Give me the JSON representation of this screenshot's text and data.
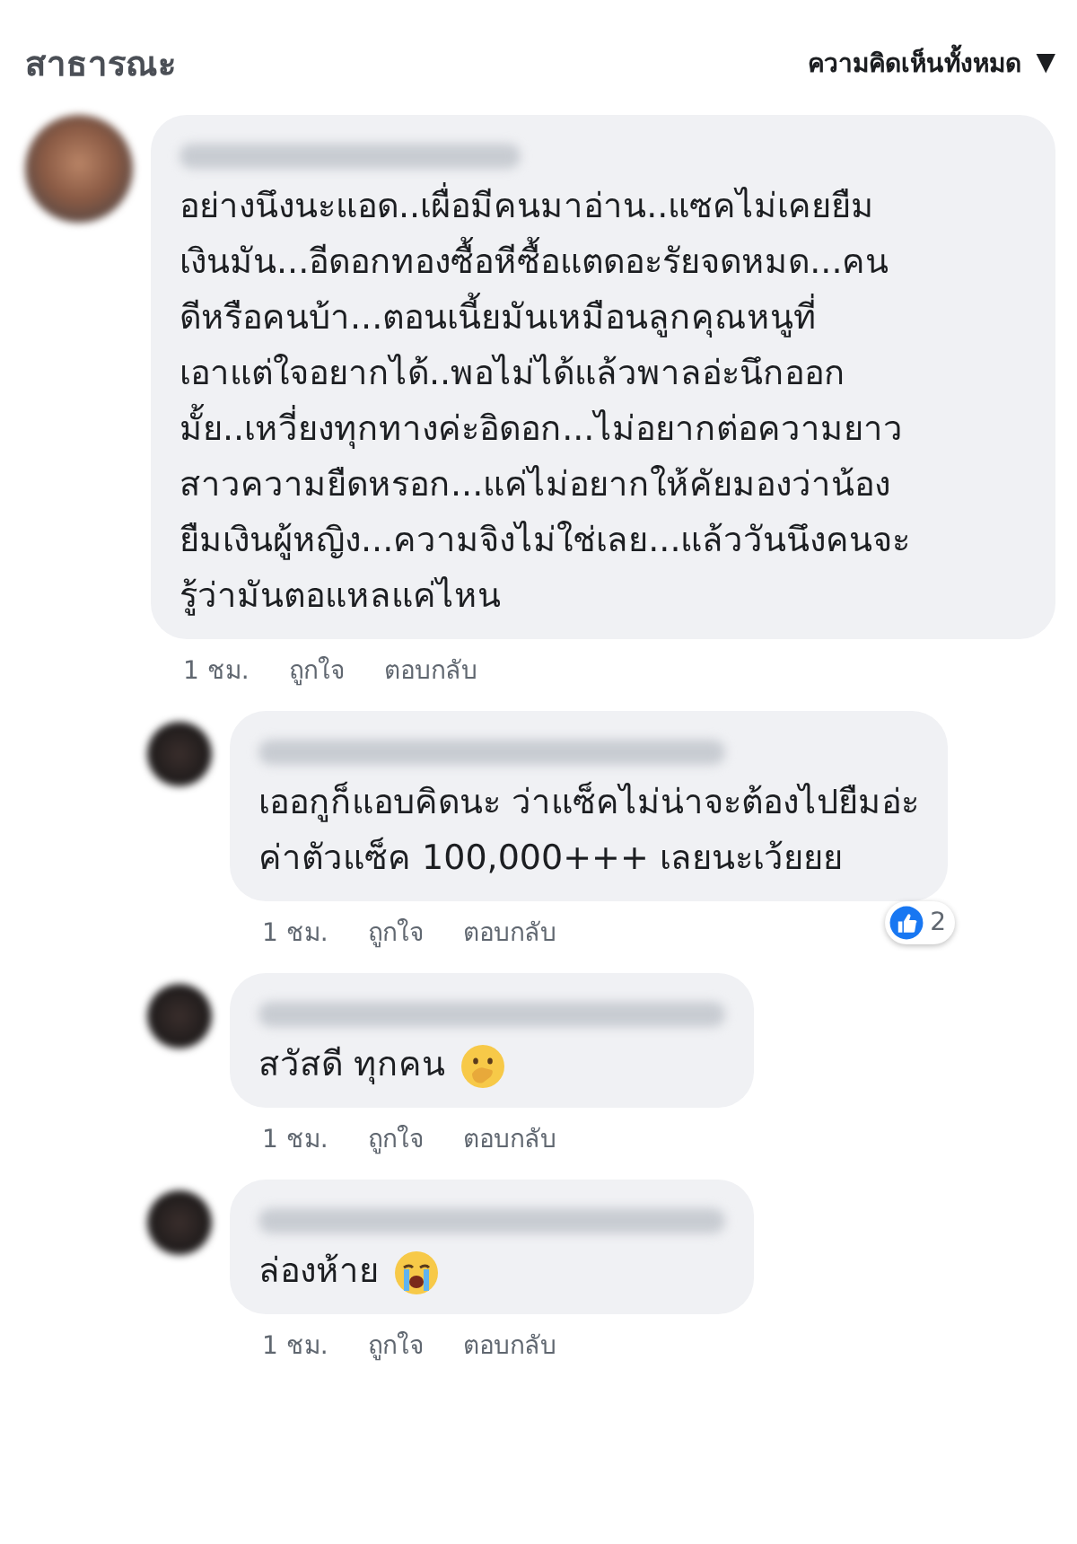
{
  "header": {
    "title": "สาธารณะ",
    "filter": {
      "label": "ความคิดเห็นทั้งหมด",
      "caret": "▼"
    }
  },
  "comments": [
    {
      "text": "อย่างนึงนะแอด..เผื่อมีคนมาอ่าน..แซคไม่เคยยืม\nเงินมัน...อีดอกทองซื้อหีซื้อแตดอะรัยจดหมด...คน\nดีหรือคนบ้า...ตอนเนี้ยมันเหมือนลูกคุณหนูที่\nเอาแต่ใจอยากได้..พอไม่ได้แล้วพาลอ่ะนึกออก\nมั้ย..เหวี่ยงทุกทางค่ะอิดอก...ไม่อยากต่อความยาว\nสาวความยืดหรอก...แค่ไม่อยากให้คัยมองว่าน้อง\nยืมเงินผู้หญิง...ความจิงไม่ใช่เลย...แล้ววันนึงคนจะ\nรู้ว่ามันตอแหลแค่ไหน",
      "time": "1 ชม.",
      "like": "ถูกใจ",
      "reply": "ตอบกลับ",
      "replies": [
        {
          "kind": "plain",
          "text": "เออกูก็แอบคิดนะ ว่าแซ็คไม่น่าจะต้องไปยืมอ่ะ\nค่าตัวแซ็ค 100,000+++ เลยนะเว้ยยย",
          "time": "1 ชม.",
          "like": "ถูกใจ",
          "reply": "ตอบกลับ",
          "reactions": "2"
        },
        {
          "kind": "covermouth",
          "text": "สวัสดี ทุกคน",
          "time": "1 ชม.",
          "like": "ถูกใจ",
          "reply": "ตอบกลับ"
        },
        {
          "kind": "crying",
          "text": "ล่องห้าย",
          "time": "1 ชม.",
          "like": "ถูกใจ",
          "reply": "ตอบกลับ"
        }
      ]
    }
  ]
}
